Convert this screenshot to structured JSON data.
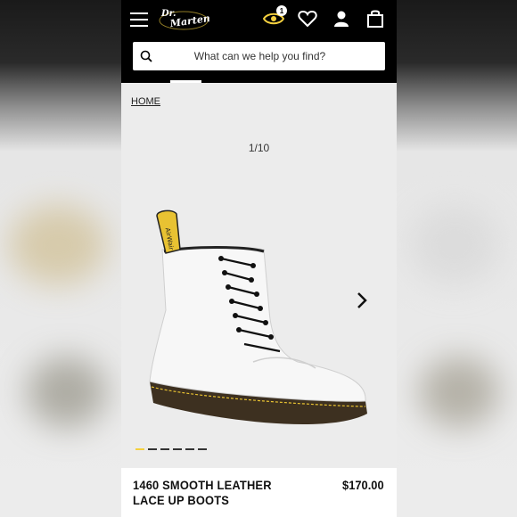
{
  "header": {
    "logo_label": "Dr. Martens",
    "wishlist_badge": "1",
    "icons": [
      "menu-icon",
      "eye-icon",
      "heart-icon",
      "account-icon",
      "bag-icon"
    ]
  },
  "search": {
    "placeholder": "What can we help you find?"
  },
  "breadcrumb": {
    "home": "HOME"
  },
  "gallery": {
    "counter": "1/10",
    "total_slides": 6,
    "active_slide": 1
  },
  "product": {
    "name_line1": "1460 SMOOTH LEATHER",
    "name_line2": "LACE UP BOOTS",
    "price": "$170.00"
  },
  "colors": {
    "header_bg": "#000000",
    "page_bg": "#ececec",
    "accent_yellow": "#f4d03f"
  }
}
